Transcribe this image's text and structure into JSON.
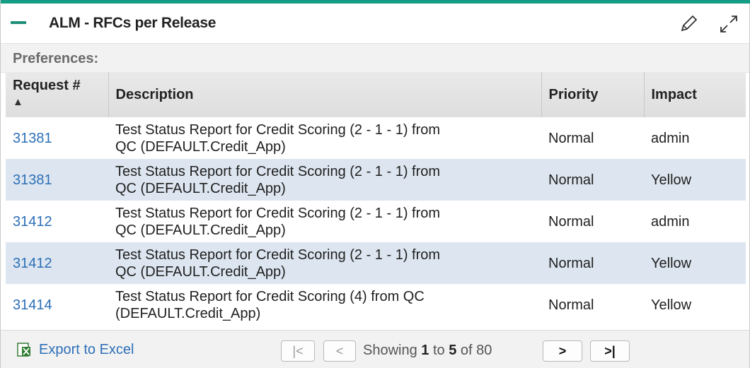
{
  "portlet": {
    "title": "ALM - RFCs per Release",
    "accent_color": "#159e85",
    "icons": [
      "minus-icon",
      "pencil-icon",
      "expand-icon"
    ]
  },
  "preferences": {
    "label": "Preferences:"
  },
  "table": {
    "columns": [
      "Request #",
      "Description",
      "Priority",
      "Impact"
    ],
    "sort_indicator": "▲",
    "rows": [
      {
        "request": "31381",
        "description_line1": "Test Status Report for Credit Scoring (2 - 1 - 1) from",
        "description_line2": "QC (DEFAULT.Credit_App)",
        "priority": "Normal",
        "impact": "admin"
      },
      {
        "request": "31381",
        "description_line1": "Test Status Report for Credit Scoring (2 - 1 - 1) from",
        "description_line2": "QC (DEFAULT.Credit_App)",
        "priority": "Normal",
        "impact": "Yellow"
      },
      {
        "request": "31412",
        "description_line1": "Test Status Report for Credit Scoring (2 - 1 - 1) from",
        "description_line2": "QC (DEFAULT.Credit_App)",
        "priority": "Normal",
        "impact": "admin"
      },
      {
        "request": "31412",
        "description_line1": "Test Status Report for Credit Scoring (2 - 1 - 1) from",
        "description_line2": "QC (DEFAULT.Credit_App)",
        "priority": "Normal",
        "impact": "Yellow"
      },
      {
        "request": "31414",
        "description_line1": "Test Status Report for Credit Scoring (4) from QC",
        "description_line2": "(DEFAULT.Credit_App)",
        "priority": "Normal",
        "impact": "Yellow"
      }
    ]
  },
  "footer": {
    "export_label": "Export to Excel",
    "showing_prefix": "Showing",
    "range_start": "1",
    "to_word": "to",
    "range_end": "5",
    "of_word": "of",
    "total": "80",
    "first_glyph": "|<",
    "prev_glyph": "<",
    "next_glyph": ">",
    "last_glyph": ">|"
  }
}
